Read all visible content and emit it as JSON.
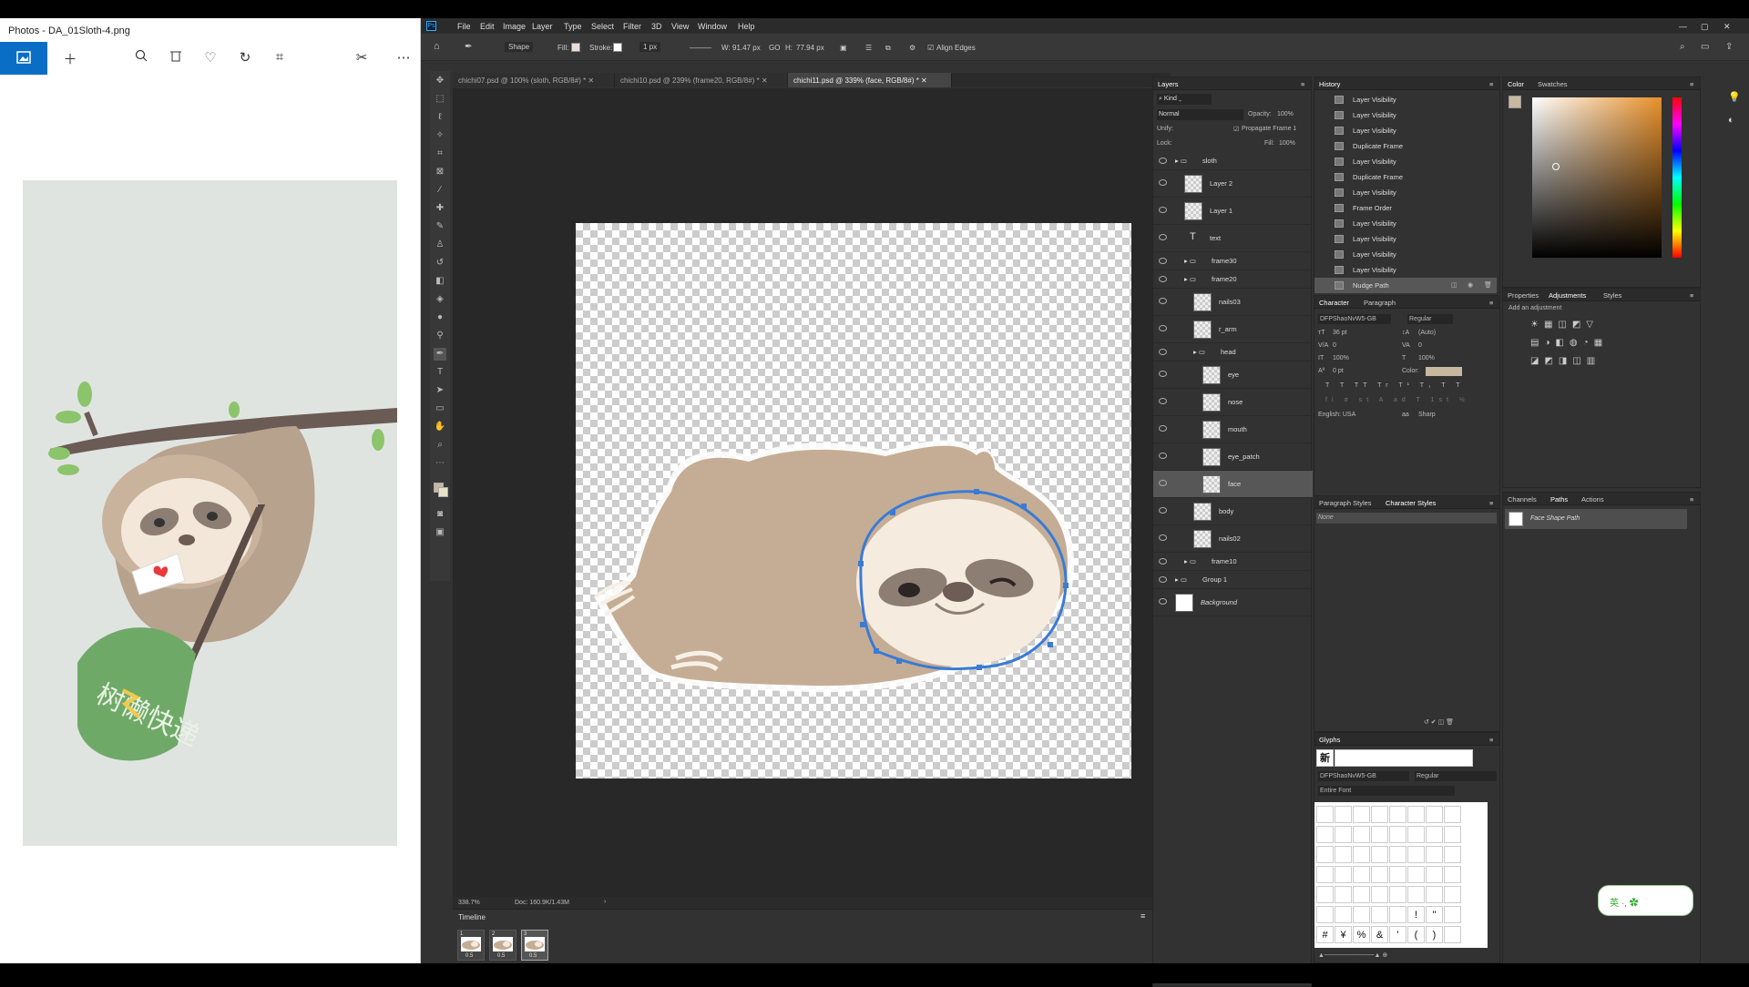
{
  "photos": {
    "title": "Photos - DA_01Sloth-4.png",
    "toolbar": [
      "image-icon",
      "add-icon",
      "zoom-icon",
      "delete-icon",
      "heart-icon",
      "rotate-icon",
      "crop-icon",
      "edit-icon",
      "more-icon"
    ]
  },
  "ps": {
    "menu": [
      "File",
      "Edit",
      "Image",
      "Layer",
      "Type",
      "Select",
      "Filter",
      "3D",
      "View",
      "Window",
      "Help"
    ],
    "options": {
      "mode": "Shape",
      "fill_label": "Fill:",
      "stroke_label": "Stroke:",
      "stroke_width": "1 px",
      "w_label": "W:",
      "w_value": "91.47 px",
      "go": "GO",
      "h_label": "H:",
      "h_value": "77.94 px",
      "align_edges": "Align Edges"
    },
    "tabs": [
      {
        "label": "chichi07.psd @ 100% (sloth, RGB/8#) *"
      },
      {
        "label": "chichi10.psd @ 239% (frame20, RGB/8#) *"
      },
      {
        "label": "chichi11.psd @ 339% (face, RGB/8#) *"
      }
    ],
    "status": {
      "zoom": "338.7%",
      "doc": "Doc: 160.9K/1.43M"
    },
    "timeline": {
      "title": "Timeline",
      "frames": [
        {
          "num": "1",
          "delay": "0.5"
        },
        {
          "num": "2",
          "delay": "0.5"
        },
        {
          "num": "3",
          "delay": "0.5"
        }
      ]
    },
    "layers": {
      "title": "Layers",
      "kind": "Kind",
      "blend": "Normal",
      "opacity_label": "Opacity:",
      "opacity": "100%",
      "unify": "Unify:",
      "propagate": "Propagate Frame 1",
      "lock": "Lock:",
      "fill_label": "Fill:",
      "fill": "100%",
      "items": [
        {
          "name": "sloth",
          "type": "group",
          "indent": 0
        },
        {
          "name": "Layer 2",
          "type": "layer",
          "indent": 1
        },
        {
          "name": "Layer 1",
          "type": "layer",
          "indent": 1
        },
        {
          "name": "text",
          "type": "text",
          "indent": 1
        },
        {
          "name": "frame30",
          "type": "group",
          "indent": 1
        },
        {
          "name": "frame20",
          "type": "group",
          "indent": 1
        },
        {
          "name": "nails03",
          "type": "layer",
          "indent": 2
        },
        {
          "name": "r_arm",
          "type": "layer",
          "indent": 2
        },
        {
          "name": "head",
          "type": "group",
          "indent": 2
        },
        {
          "name": "eye",
          "type": "layer",
          "indent": 3
        },
        {
          "name": "nose",
          "type": "layer",
          "indent": 3
        },
        {
          "name": "mouth",
          "type": "layer",
          "indent": 3
        },
        {
          "name": "eye_patch",
          "type": "layer",
          "indent": 3
        },
        {
          "name": "face",
          "type": "layer",
          "indent": 3
        },
        {
          "name": "body",
          "type": "layer",
          "indent": 2
        },
        {
          "name": "nails02",
          "type": "layer",
          "indent": 2
        },
        {
          "name": "frame10",
          "type": "group",
          "indent": 1
        },
        {
          "name": "Group 1",
          "type": "group",
          "indent": 0
        },
        {
          "name": "Background",
          "type": "bg",
          "indent": 0
        }
      ]
    },
    "history": {
      "title": "History",
      "items": [
        "Layer Visibility",
        "Layer Visibility",
        "Layer Visibility",
        "Duplicate Frame",
        "Layer Visibility",
        "Duplicate Frame",
        "Layer Visibility",
        "Frame Order",
        "Layer Visibility",
        "Layer Visibility",
        "Layer Visibility",
        "Layer Visibility",
        "Nudge Path"
      ]
    },
    "color": {
      "title": "Color",
      "tab2": "Swatches"
    },
    "adjust": {
      "tabs": [
        "Properties",
        "Adjustments",
        "Styles"
      ],
      "label": "Add an adjustment"
    },
    "character": {
      "tabs": [
        "Character",
        "Paragraph"
      ],
      "font": "DFPShaoNvW5-GB",
      "style": "Regular",
      "size": "36 pt",
      "leading": "(Auto)",
      "kern": "0",
      "track": "0",
      "vscale": "100%",
      "hscale": "100%",
      "baseline": "0 pt",
      "color_label": "Color:",
      "lang": "English: USA",
      "aa": "Sharp",
      "aa_label": "aa"
    },
    "styles": {
      "tabs": [
        "Paragraph Styles",
        "Character Styles"
      ],
      "item": "None"
    },
    "paths": {
      "tabs": [
        "Channels",
        "Paths",
        "Actions"
      ],
      "item": "Face Shape Path"
    },
    "glyphs": {
      "title": "Glyphs",
      "recent": "新",
      "font": "DFPShaoNvW5-GB",
      "style": "Regular",
      "subset": "Entire Font",
      "bottom_row": [
        "#",
        "¥",
        "%",
        "&",
        "'",
        "(",
        ")"
      ],
      "row2": [
        "!",
        "\""
      ]
    },
    "ime": "英 ·, ✿"
  }
}
